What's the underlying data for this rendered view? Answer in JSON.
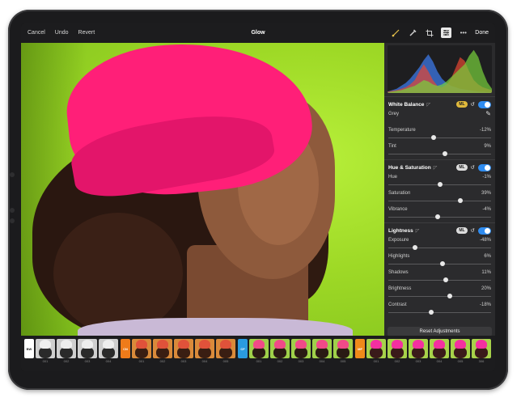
{
  "topbar": {
    "cancel": "Cancel",
    "undo": "Undo",
    "revert": "Revert",
    "title": "Glow",
    "done": "Done",
    "icons": [
      "brush-icon",
      "pencil-icon",
      "crop-icon",
      "sliders-icon",
      "more-icon"
    ]
  },
  "histogram": {
    "red": [
      2,
      3,
      4,
      6,
      8,
      12,
      18,
      30,
      40,
      30,
      18,
      10,
      8,
      12,
      20,
      35,
      50,
      45,
      30,
      18,
      12,
      8,
      6,
      4
    ],
    "green": [
      1,
      2,
      3,
      4,
      6,
      8,
      10,
      14,
      18,
      16,
      12,
      10,
      12,
      16,
      22,
      28,
      34,
      40,
      52,
      60,
      50,
      30,
      15,
      6
    ],
    "blue": [
      2,
      4,
      6,
      10,
      14,
      20,
      28,
      36,
      46,
      54,
      44,
      30,
      20,
      14,
      10,
      8,
      6,
      5,
      4,
      3,
      2,
      2,
      1,
      1
    ]
  },
  "sections": [
    {
      "title": "White Balance",
      "ml": "ML",
      "ml_active": true,
      "rows": [
        {
          "label": "Grey",
          "value": "",
          "pos": null,
          "dropper": true
        },
        {
          "label": "Temperature",
          "value": "-12%",
          "pos": 0.44
        },
        {
          "label": "Tint",
          "value": "9%",
          "pos": 0.55
        }
      ]
    },
    {
      "title": "Hue & Saturation",
      "ml": "ML",
      "ml_active": false,
      "rows": [
        {
          "label": "Hue",
          "value": "-1%",
          "pos": 0.5
        },
        {
          "label": "Saturation",
          "value": "39%",
          "pos": 0.7
        },
        {
          "label": "Vibrance",
          "value": "-4%",
          "pos": 0.48
        }
      ]
    },
    {
      "title": "Lightness",
      "ml": "ML",
      "ml_active": false,
      "rows": [
        {
          "label": "Exposure",
          "value": "-48%",
          "pos": 0.26
        },
        {
          "label": "Highlights",
          "value": "6%",
          "pos": 0.53
        },
        {
          "label": "Shadows",
          "value": "11%",
          "pos": 0.56
        },
        {
          "label": "Brightness",
          "value": "20%",
          "pos": 0.6
        },
        {
          "label": "Contrast",
          "value": "-18%",
          "pos": 0.42
        }
      ]
    }
  ],
  "reset_adjustments": "Reset Adjustments",
  "filmstrip": {
    "groups": [
      {
        "tag": "BW",
        "tag_color": "#ffffff",
        "tag_text": "#222222",
        "style": "bw",
        "items": [
          "001",
          "002",
          "003",
          "004"
        ]
      },
      {
        "tag": "CN",
        "tag_color": "#ef7b1a",
        "tag_text": "#ffffff",
        "style": "warm",
        "items": [
          "001",
          "002",
          "003",
          "004",
          "005"
        ]
      },
      {
        "tag": "CF",
        "tag_color": "#2a9be0",
        "tag_text": "#ffffff",
        "style": "cool",
        "items": [
          "001",
          "002",
          "003",
          "004",
          "005"
        ]
      },
      {
        "tag": "MF",
        "tag_color": "#ef8a1a",
        "tag_text": "#ffffff",
        "style": "magenta",
        "items": [
          "001",
          "002",
          "003",
          "004",
          "005",
          "306"
        ]
      }
    ]
  }
}
